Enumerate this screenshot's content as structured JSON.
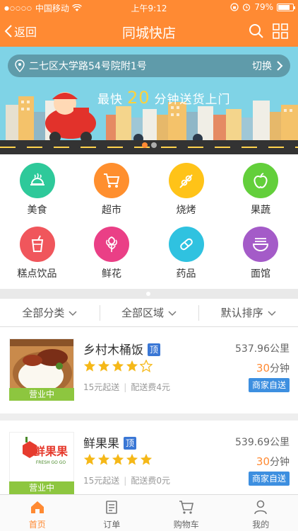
{
  "status_bar": {
    "carrier": "中国移动",
    "time": "上午9:12",
    "battery": "79%",
    "battery_level": 0.79
  },
  "nav": {
    "back_label": "返回",
    "title": "同城快店",
    "icons": [
      "search-icon",
      "grid-icon"
    ]
  },
  "banner": {
    "address": "二七区大学路54号院附1号",
    "switch_label": "切换",
    "slogan_prefix": "最快",
    "slogan_number": "20",
    "slogan_suffix": "分钟送货上门",
    "slide_count": 2,
    "active_slide": 1
  },
  "categories": [
    {
      "label": "美食",
      "icon": "food-dish-icon",
      "color": "#2ec99a"
    },
    {
      "label": "超市",
      "icon": "shopping-cart-icon",
      "color": "#ff8f2e"
    },
    {
      "label": "烧烤",
      "icon": "bbq-skewer-icon",
      "color": "#ffc318"
    },
    {
      "label": "果蔬",
      "icon": "apple-icon",
      "color": "#63cf3b"
    },
    {
      "label": "糕点饮品",
      "icon": "drink-cup-icon",
      "color": "#f0565c"
    },
    {
      "label": "鲜花",
      "icon": "flower-icon",
      "color": "#ea3f86"
    },
    {
      "label": "药品",
      "icon": "pill-icon",
      "color": "#2fc2e0"
    },
    {
      "label": "面馆",
      "icon": "noodle-bowl-icon",
      "color": "#a45bc8"
    }
  ],
  "filters": [
    {
      "label": "全部分类"
    },
    {
      "label": "全部区域"
    },
    {
      "label": "默认排序"
    }
  ],
  "shops": [
    {
      "name": "乡村木桶饭",
      "badge": "顶",
      "distance": "537.96公里",
      "rating": 4,
      "rating_max": 5,
      "time_value": "30",
      "time_unit": "分钟",
      "min_order": "15元起送",
      "delivery_fee": "配送费4元",
      "delivery_tag": "商家自送",
      "status": "营业中"
    },
    {
      "name": "鲜果果",
      "badge": "顶",
      "distance": "539.69公里",
      "rating": 5,
      "rating_max": 5,
      "time_value": "30",
      "time_unit": "分钟",
      "min_order": "15元起送",
      "delivery_fee": "配送费0元",
      "delivery_tag": "商家自送",
      "status": "营业中",
      "logo_text": "鲜果果",
      "logo_sub": "FRESH GO GO"
    }
  ],
  "tabs": [
    {
      "label": "首页",
      "icon": "home-icon",
      "active": true
    },
    {
      "label": "订单",
      "icon": "order-list-icon",
      "active": false
    },
    {
      "label": "购物车",
      "icon": "cart-icon",
      "active": false
    },
    {
      "label": "我的",
      "icon": "user-icon",
      "active": false
    }
  ],
  "colors": {
    "brand": "#ff8a33",
    "open_status": "#8dc63f",
    "delivery_tag": "#3d8fe0",
    "badge": "#3a77d5",
    "star": "#f5b818"
  }
}
